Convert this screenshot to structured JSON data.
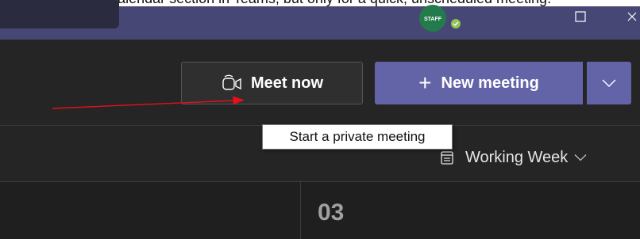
{
  "caption": {
    "text": "meeting via the Calendar section in Teams, but only for a quick, unscheduled meeting."
  },
  "titlebar": {
    "avatar_text": "STAFF",
    "presence": "available",
    "window_controls": [
      "restore-icon",
      "close-icon"
    ]
  },
  "toolbar": {
    "meet_now_label": "Meet now",
    "new_meeting_label": "New meeting",
    "new_meeting_plus": "+",
    "accent_color": "#6264a7"
  },
  "tooltip": {
    "text": "Start a private meeting"
  },
  "view": {
    "label": "Working Week"
  },
  "calendar": {
    "day_number": "03"
  },
  "annotation": {
    "color": "#e8101a"
  }
}
